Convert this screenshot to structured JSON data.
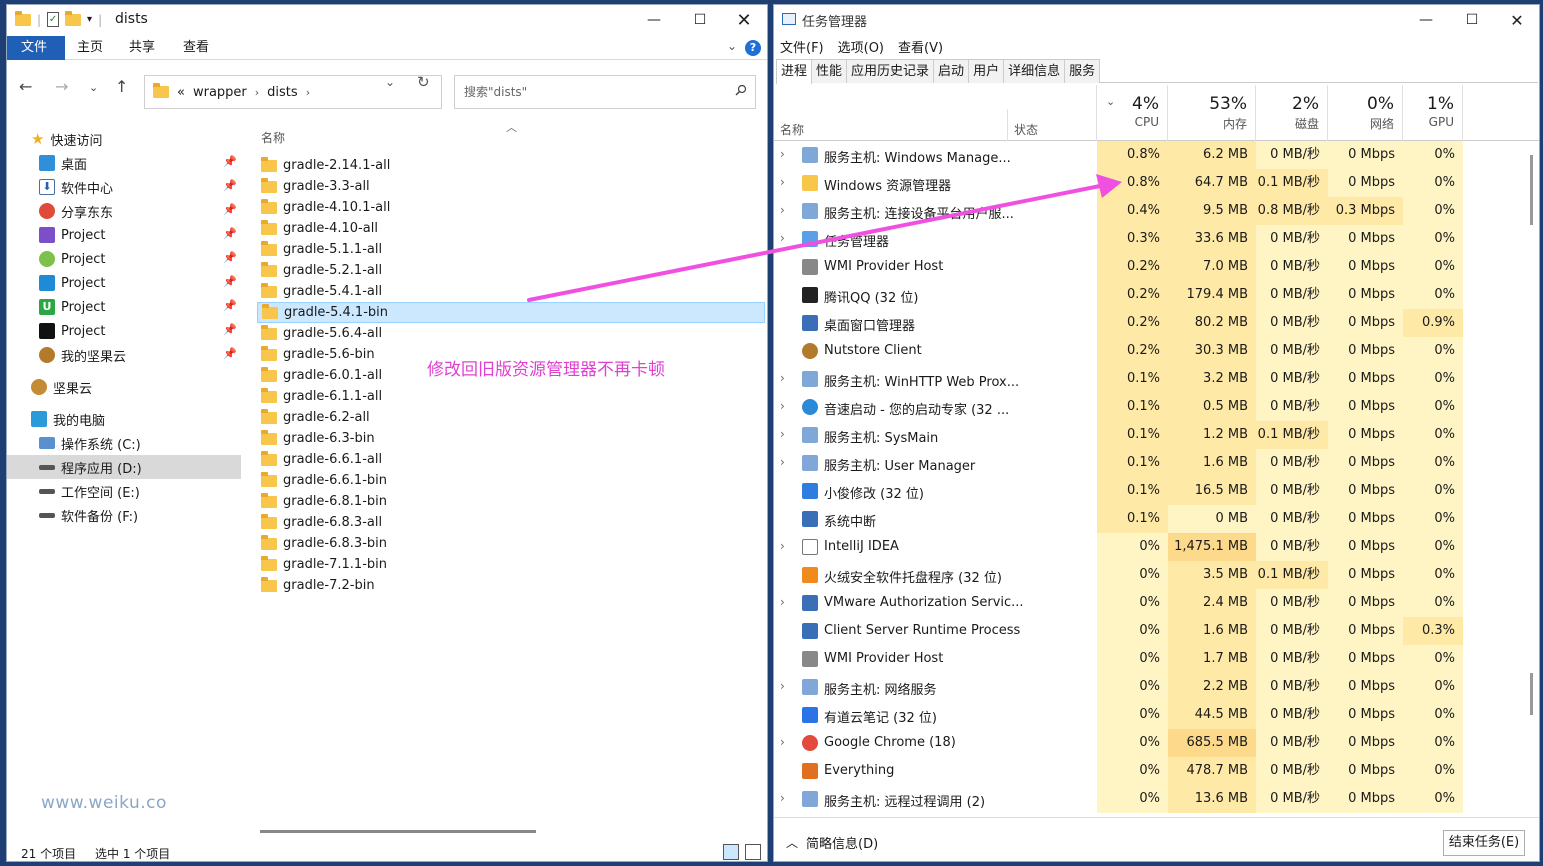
{
  "explorer": {
    "title": "dists",
    "ribbon_tabs": [
      "文件",
      "主页",
      "共享",
      "查看"
    ],
    "address": {
      "root_sep": "«",
      "segments": [
        "wrapper",
        "dists"
      ]
    },
    "search_placeholder": "搜索\"dists\"",
    "nav_items": [
      {
        "label": "快速访问",
        "icon": "star-icon",
        "pinned": false
      },
      {
        "label": "桌面",
        "icon": "desktop-icon",
        "pinned": true
      },
      {
        "label": "软件中心",
        "icon": "download-icon",
        "pinned": true
      },
      {
        "label": "分享东东",
        "icon": "share-icon",
        "pinned": true
      },
      {
        "label": "Project",
        "icon": "visual-studio-icon",
        "pinned": true
      },
      {
        "label": "Project",
        "icon": "android-icon",
        "pinned": true
      },
      {
        "label": "Project",
        "icon": "vscode-icon",
        "pinned": true
      },
      {
        "label": "Project",
        "icon": "intellij-u-icon",
        "pinned": true
      },
      {
        "label": "Project",
        "icon": "jetbrains-icon",
        "pinned": true
      },
      {
        "label": "我的坚果云",
        "icon": "nutstore-icon",
        "pinned": true
      },
      {
        "label": "坚果云",
        "icon": "nutstore-icon",
        "pinned": false
      },
      {
        "label": "我的电脑",
        "icon": "computer-icon",
        "pinned": false
      },
      {
        "label": "操作系统 (C:)",
        "icon": "windows-drive-icon",
        "pinned": false
      },
      {
        "label": "程序应用 (D:)",
        "icon": "drive-icon",
        "pinned": false
      },
      {
        "label": "工作空间 (E:)",
        "icon": "drive-icon",
        "pinned": false
      },
      {
        "label": "软件备份 (F:)",
        "icon": "drive-icon",
        "pinned": false
      }
    ],
    "column_name": "名称",
    "files": [
      "gradle-2.14.1-all",
      "gradle-3.3-all",
      "gradle-4.10.1-all",
      "gradle-4.10-all",
      "gradle-5.1.1-all",
      "gradle-5.2.1-all",
      "gradle-5.4.1-all",
      "gradle-5.4.1-bin",
      "gradle-5.6.4-all",
      "gradle-5.6-bin",
      "gradle-6.0.1-all",
      "gradle-6.1.1-all",
      "gradle-6.2-all",
      "gradle-6.3-bin",
      "gradle-6.6.1-all",
      "gradle-6.6.1-bin",
      "gradle-6.8.1-bin",
      "gradle-6.8.3-all",
      "gradle-6.8.3-bin",
      "gradle-7.1.1-bin",
      "gradle-7.2-bin"
    ],
    "selected_file": "gradle-5.4.1-bin",
    "annotation": "修改回旧版资源管理器不再卡顿",
    "watermark": "www.weiku.co",
    "status_count": "21 个项目",
    "status_selected": "选中 1 个项目"
  },
  "taskmgr": {
    "title": "任务管理器",
    "menu": [
      "文件(F)",
      "选项(O)",
      "查看(V)"
    ],
    "tabs": [
      "进程",
      "性能",
      "应用历史记录",
      "启动",
      "用户",
      "详细信息",
      "服务"
    ],
    "header": {
      "name": "名称",
      "status": "状态",
      "cpu_pct": "4%",
      "cpu_label": "CPU",
      "mem_pct": "53%",
      "mem_label": "内存",
      "disk_pct": "2%",
      "disk_label": "磁盘",
      "net_pct": "0%",
      "net_label": "网络",
      "gpu_pct": "1%",
      "gpu_label": "GPU"
    },
    "processes": [
      {
        "name": "服务主机: Windows Manage...",
        "icon": "service-gear-icon",
        "exp": true,
        "cpu": "0.8%",
        "mem": "6.2 MB",
        "disk": "0 MB/秒",
        "net": "0 Mbps",
        "gpu": "0%"
      },
      {
        "name": "Windows 资源管理器",
        "icon": "folder-icon",
        "exp": true,
        "cpu": "0.8%",
        "mem": "64.7 MB",
        "disk": "0.1 MB/秒",
        "net": "0 Mbps",
        "gpu": "0%"
      },
      {
        "name": "服务主机: 连接设备平台用户服...",
        "icon": "service-gear-icon",
        "exp": true,
        "cpu": "0.4%",
        "mem": "9.5 MB",
        "disk": "0.8 MB/秒",
        "net": "0.3 Mbps",
        "gpu": "0%"
      },
      {
        "name": "任务管理器",
        "icon": "taskmgr-icon",
        "exp": true,
        "cpu": "0.3%",
        "mem": "33.6 MB",
        "disk": "0 MB/秒",
        "net": "0 Mbps",
        "gpu": "0%"
      },
      {
        "name": "WMI Provider Host",
        "icon": "wmi-icon",
        "exp": false,
        "cpu": "0.2%",
        "mem": "7.0 MB",
        "disk": "0 MB/秒",
        "net": "0 Mbps",
        "gpu": "0%"
      },
      {
        "name": "腾讯QQ (32 位)",
        "icon": "qq-penguin-icon",
        "exp": false,
        "cpu": "0.2%",
        "mem": "179.4 MB",
        "disk": "0 MB/秒",
        "net": "0 Mbps",
        "gpu": "0%"
      },
      {
        "name": "桌面窗口管理器",
        "icon": "window-icon",
        "exp": false,
        "cpu": "0.2%",
        "mem": "80.2 MB",
        "disk": "0 MB/秒",
        "net": "0 Mbps",
        "gpu": "0.9%"
      },
      {
        "name": "Nutstore Client",
        "icon": "nutstore-icon",
        "exp": false,
        "cpu": "0.2%",
        "mem": "30.3 MB",
        "disk": "0 MB/秒",
        "net": "0 Mbps",
        "gpu": "0%"
      },
      {
        "name": "服务主机: WinHTTP Web Prox...",
        "icon": "service-gear-icon",
        "exp": true,
        "cpu": "0.1%",
        "mem": "3.2 MB",
        "disk": "0 MB/秒",
        "net": "0 Mbps",
        "gpu": "0%"
      },
      {
        "name": "音速启动 - 您的启动专家 (32 ...",
        "icon": "launcher-icon",
        "exp": true,
        "cpu": "0.1%",
        "mem": "0.5 MB",
        "disk": "0 MB/秒",
        "net": "0 Mbps",
        "gpu": "0%"
      },
      {
        "name": "服务主机: SysMain",
        "icon": "service-gear-icon",
        "exp": true,
        "cpu": "0.1%",
        "mem": "1.2 MB",
        "disk": "0.1 MB/秒",
        "net": "0 Mbps",
        "gpu": "0%"
      },
      {
        "name": "服务主机: User Manager",
        "icon": "service-gear-icon",
        "exp": true,
        "cpu": "0.1%",
        "mem": "1.6 MB",
        "disk": "0 MB/秒",
        "net": "0 Mbps",
        "gpu": "0%"
      },
      {
        "name": "小俊修改 (32 位)",
        "icon": "app-icon",
        "exp": false,
        "cpu": "0.1%",
        "mem": "16.5 MB",
        "disk": "0 MB/秒",
        "net": "0 Mbps",
        "gpu": "0%"
      },
      {
        "name": "系统中断",
        "icon": "window-icon",
        "exp": false,
        "cpu": "0.1%",
        "mem": "0 MB",
        "disk": "0 MB/秒",
        "net": "0 Mbps",
        "gpu": "0%"
      },
      {
        "name": "IntelliJ IDEA",
        "icon": "file-icon",
        "exp": true,
        "cpu": "0%",
        "mem": "1,475.1 MB",
        "disk": "0 MB/秒",
        "net": "0 Mbps",
        "gpu": "0%"
      },
      {
        "name": "火绒安全软件托盘程序 (32 位)",
        "icon": "huorong-icon",
        "exp": false,
        "cpu": "0%",
        "mem": "3.5 MB",
        "disk": "0.1 MB/秒",
        "net": "0 Mbps",
        "gpu": "0%"
      },
      {
        "name": "VMware Authorization Servic...",
        "icon": "window-icon",
        "exp": true,
        "cpu": "0%",
        "mem": "2.4 MB",
        "disk": "0 MB/秒",
        "net": "0 Mbps",
        "gpu": "0%"
      },
      {
        "name": "Client Server Runtime Process",
        "icon": "window-icon",
        "exp": false,
        "cpu": "0%",
        "mem": "1.6 MB",
        "disk": "0 MB/秒",
        "net": "0 Mbps",
        "gpu": "0.3%"
      },
      {
        "name": "WMI Provider Host",
        "icon": "wmi-icon",
        "exp": false,
        "cpu": "0%",
        "mem": "1.7 MB",
        "disk": "0 MB/秒",
        "net": "0 Mbps",
        "gpu": "0%"
      },
      {
        "name": "服务主机: 网络服务",
        "icon": "service-gear-icon",
        "exp": true,
        "cpu": "0%",
        "mem": "2.2 MB",
        "disk": "0 MB/秒",
        "net": "0 Mbps",
        "gpu": "0%"
      },
      {
        "name": "有道云笔记 (32 位)",
        "icon": "youdao-icon",
        "exp": false,
        "cpu": "0%",
        "mem": "44.5 MB",
        "disk": "0 MB/秒",
        "net": "0 Mbps",
        "gpu": "0%"
      },
      {
        "name": "Google Chrome (18)",
        "icon": "chrome-icon",
        "exp": true,
        "cpu": "0%",
        "mem": "685.5 MB",
        "disk": "0 MB/秒",
        "net": "0 Mbps",
        "gpu": "0%"
      },
      {
        "name": "Everything",
        "icon": "magnifier-icon",
        "exp": false,
        "cpu": "0%",
        "mem": "478.7 MB",
        "disk": "0 MB/秒",
        "net": "0 Mbps",
        "gpu": "0%"
      },
      {
        "name": "服务主机: 远程过程调用 (2)",
        "icon": "service-gear-icon",
        "exp": true,
        "cpu": "0%",
        "mem": "13.6 MB",
        "disk": "0 MB/秒",
        "net": "0 Mbps",
        "gpu": "0%"
      }
    ],
    "fewer_details": "简略信息(D)",
    "end_task": "结束任务(E)"
  },
  "colors": {
    "heat_light": "#fff4c4",
    "heat_mid": "#ffe9a6",
    "heat_strong": "#fcd98b",
    "selection": "#cce8ff",
    "annotation": "#e040d0",
    "file_tab": "#1f5fb5"
  }
}
